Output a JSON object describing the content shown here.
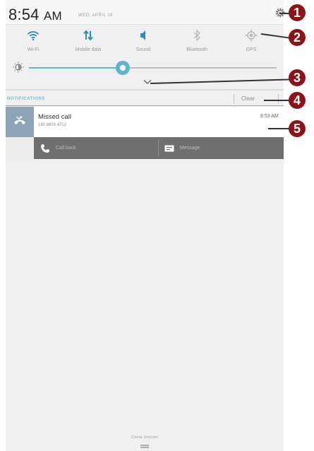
{
  "status_bar": {
    "time": "8:54",
    "ampm": "AM",
    "date": "WED, APRIL 16"
  },
  "quick_toggles": [
    {
      "label": "Wi-Fi",
      "icon": "wifi-icon",
      "active": true
    },
    {
      "label": "Mobile data",
      "icon": "mobile-data-icon",
      "active": true
    },
    {
      "label": "Sound",
      "icon": "sound-icon",
      "active": true
    },
    {
      "label": "Bluetooth",
      "icon": "bluetooth-icon",
      "active": false
    },
    {
      "label": "GPS",
      "icon": "gps-icon",
      "active": false
    }
  ],
  "brightness": {
    "icon": "brightness-icon",
    "level": 0.37
  },
  "notifications_header": {
    "label": "NOTIFICATIONS",
    "clear_label": "Clear"
  },
  "notification": {
    "title": "Missed call",
    "number": "180 8603 4712",
    "time": "8:53 AM",
    "icon": "missed-call-icon"
  },
  "notification_actions": [
    {
      "label": "Call back",
      "icon": "phone-icon"
    },
    {
      "label": "Message",
      "icon": "message-icon"
    }
  ],
  "carrier": "China Unicom",
  "callouts": [
    "1",
    "2",
    "3",
    "4",
    "5"
  ],
  "colors": {
    "accent": "#5fb3cc",
    "active_icon": "#2c8fb5",
    "inactive_icon": "#b8b8b8",
    "callout": "#8b1418",
    "action_bar": "#6f6f6f"
  }
}
